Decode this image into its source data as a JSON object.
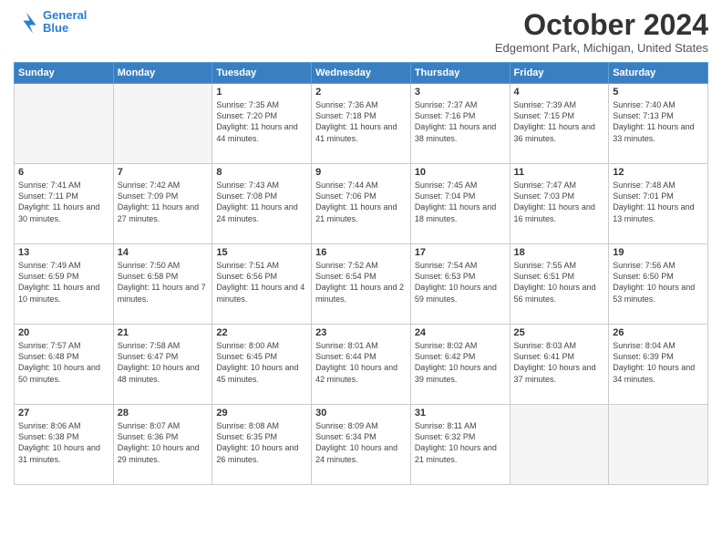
{
  "header": {
    "logo_line1": "General",
    "logo_line2": "Blue",
    "month_title": "October 2024",
    "location": "Edgemont Park, Michigan, United States"
  },
  "days_of_week": [
    "Sunday",
    "Monday",
    "Tuesday",
    "Wednesday",
    "Thursday",
    "Friday",
    "Saturday"
  ],
  "weeks": [
    [
      {
        "date": "",
        "empty": true
      },
      {
        "date": "",
        "empty": true
      },
      {
        "date": "1",
        "sunrise": "Sunrise: 7:35 AM",
        "sunset": "Sunset: 7:20 PM",
        "daylight": "Daylight: 11 hours and 44 minutes."
      },
      {
        "date": "2",
        "sunrise": "Sunrise: 7:36 AM",
        "sunset": "Sunset: 7:18 PM",
        "daylight": "Daylight: 11 hours and 41 minutes."
      },
      {
        "date": "3",
        "sunrise": "Sunrise: 7:37 AM",
        "sunset": "Sunset: 7:16 PM",
        "daylight": "Daylight: 11 hours and 38 minutes."
      },
      {
        "date": "4",
        "sunrise": "Sunrise: 7:39 AM",
        "sunset": "Sunset: 7:15 PM",
        "daylight": "Daylight: 11 hours and 36 minutes."
      },
      {
        "date": "5",
        "sunrise": "Sunrise: 7:40 AM",
        "sunset": "Sunset: 7:13 PM",
        "daylight": "Daylight: 11 hours and 33 minutes."
      }
    ],
    [
      {
        "date": "6",
        "sunrise": "Sunrise: 7:41 AM",
        "sunset": "Sunset: 7:11 PM",
        "daylight": "Daylight: 11 hours and 30 minutes."
      },
      {
        "date": "7",
        "sunrise": "Sunrise: 7:42 AM",
        "sunset": "Sunset: 7:09 PM",
        "daylight": "Daylight: 11 hours and 27 minutes."
      },
      {
        "date": "8",
        "sunrise": "Sunrise: 7:43 AM",
        "sunset": "Sunset: 7:08 PM",
        "daylight": "Daylight: 11 hours and 24 minutes."
      },
      {
        "date": "9",
        "sunrise": "Sunrise: 7:44 AM",
        "sunset": "Sunset: 7:06 PM",
        "daylight": "Daylight: 11 hours and 21 minutes."
      },
      {
        "date": "10",
        "sunrise": "Sunrise: 7:45 AM",
        "sunset": "Sunset: 7:04 PM",
        "daylight": "Daylight: 11 hours and 18 minutes."
      },
      {
        "date": "11",
        "sunrise": "Sunrise: 7:47 AM",
        "sunset": "Sunset: 7:03 PM",
        "daylight": "Daylight: 11 hours and 16 minutes."
      },
      {
        "date": "12",
        "sunrise": "Sunrise: 7:48 AM",
        "sunset": "Sunset: 7:01 PM",
        "daylight": "Daylight: 11 hours and 13 minutes."
      }
    ],
    [
      {
        "date": "13",
        "sunrise": "Sunrise: 7:49 AM",
        "sunset": "Sunset: 6:59 PM",
        "daylight": "Daylight: 11 hours and 10 minutes."
      },
      {
        "date": "14",
        "sunrise": "Sunrise: 7:50 AM",
        "sunset": "Sunset: 6:58 PM",
        "daylight": "Daylight: 11 hours and 7 minutes."
      },
      {
        "date": "15",
        "sunrise": "Sunrise: 7:51 AM",
        "sunset": "Sunset: 6:56 PM",
        "daylight": "Daylight: 11 hours and 4 minutes."
      },
      {
        "date": "16",
        "sunrise": "Sunrise: 7:52 AM",
        "sunset": "Sunset: 6:54 PM",
        "daylight": "Daylight: 11 hours and 2 minutes."
      },
      {
        "date": "17",
        "sunrise": "Sunrise: 7:54 AM",
        "sunset": "Sunset: 6:53 PM",
        "daylight": "Daylight: 10 hours and 59 minutes."
      },
      {
        "date": "18",
        "sunrise": "Sunrise: 7:55 AM",
        "sunset": "Sunset: 6:51 PM",
        "daylight": "Daylight: 10 hours and 56 minutes."
      },
      {
        "date": "19",
        "sunrise": "Sunrise: 7:56 AM",
        "sunset": "Sunset: 6:50 PM",
        "daylight": "Daylight: 10 hours and 53 minutes."
      }
    ],
    [
      {
        "date": "20",
        "sunrise": "Sunrise: 7:57 AM",
        "sunset": "Sunset: 6:48 PM",
        "daylight": "Daylight: 10 hours and 50 minutes."
      },
      {
        "date": "21",
        "sunrise": "Sunrise: 7:58 AM",
        "sunset": "Sunset: 6:47 PM",
        "daylight": "Daylight: 10 hours and 48 minutes."
      },
      {
        "date": "22",
        "sunrise": "Sunrise: 8:00 AM",
        "sunset": "Sunset: 6:45 PM",
        "daylight": "Daylight: 10 hours and 45 minutes."
      },
      {
        "date": "23",
        "sunrise": "Sunrise: 8:01 AM",
        "sunset": "Sunset: 6:44 PM",
        "daylight": "Daylight: 10 hours and 42 minutes."
      },
      {
        "date": "24",
        "sunrise": "Sunrise: 8:02 AM",
        "sunset": "Sunset: 6:42 PM",
        "daylight": "Daylight: 10 hours and 39 minutes."
      },
      {
        "date": "25",
        "sunrise": "Sunrise: 8:03 AM",
        "sunset": "Sunset: 6:41 PM",
        "daylight": "Daylight: 10 hours and 37 minutes."
      },
      {
        "date": "26",
        "sunrise": "Sunrise: 8:04 AM",
        "sunset": "Sunset: 6:39 PM",
        "daylight": "Daylight: 10 hours and 34 minutes."
      }
    ],
    [
      {
        "date": "27",
        "sunrise": "Sunrise: 8:06 AM",
        "sunset": "Sunset: 6:38 PM",
        "daylight": "Daylight: 10 hours and 31 minutes."
      },
      {
        "date": "28",
        "sunrise": "Sunrise: 8:07 AM",
        "sunset": "Sunset: 6:36 PM",
        "daylight": "Daylight: 10 hours and 29 minutes."
      },
      {
        "date": "29",
        "sunrise": "Sunrise: 8:08 AM",
        "sunset": "Sunset: 6:35 PM",
        "daylight": "Daylight: 10 hours and 26 minutes."
      },
      {
        "date": "30",
        "sunrise": "Sunrise: 8:09 AM",
        "sunset": "Sunset: 6:34 PM",
        "daylight": "Daylight: 10 hours and 24 minutes."
      },
      {
        "date": "31",
        "sunrise": "Sunrise: 8:11 AM",
        "sunset": "Sunset: 6:32 PM",
        "daylight": "Daylight: 10 hours and 21 minutes."
      },
      {
        "date": "",
        "empty": true
      },
      {
        "date": "",
        "empty": true
      }
    ]
  ]
}
